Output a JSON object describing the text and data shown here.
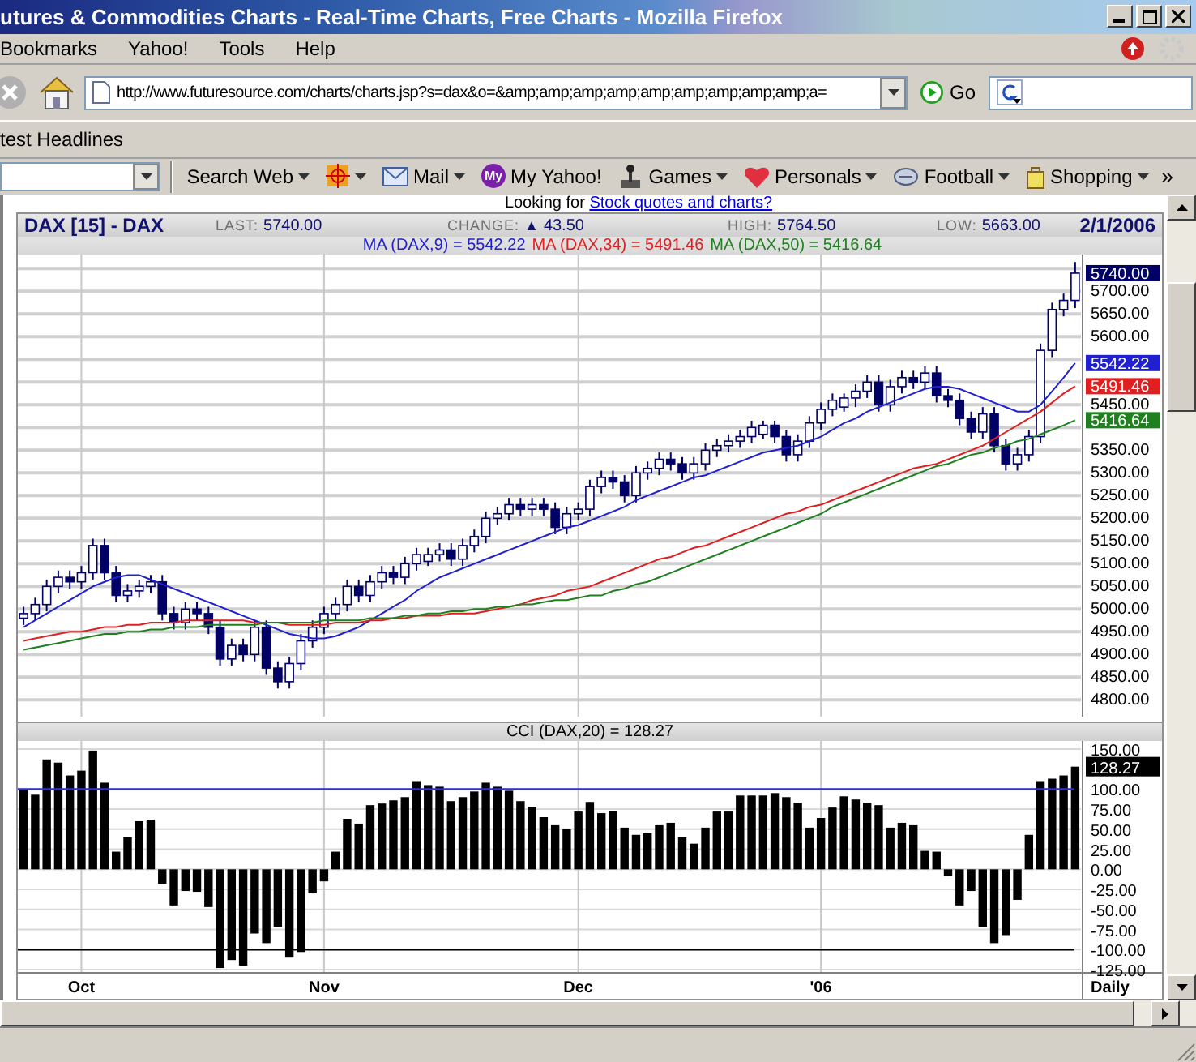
{
  "window": {
    "title": "utures & Commodities Charts - Real-Time Charts, Free Charts - Mozilla Firefox"
  },
  "menu": [
    "Bookmarks",
    "Yahoo!",
    "Tools",
    "Help"
  ],
  "navigation": {
    "url": "http://www.futuresource.com/charts/charts.jsp?s=dax&o=&amp;amp;amp;amp;amp;amp;amp;amp;amp;a=",
    "go_label": "Go"
  },
  "bookmarks": [
    "test Headlines"
  ],
  "yahoo_toolbar": {
    "items": [
      {
        "kind": "text",
        "label": "Search Web",
        "dropdown": true
      },
      {
        "kind": "crosshair",
        "dropdown": true
      },
      {
        "kind": "mail",
        "label": "Mail",
        "dropdown": true
      },
      {
        "kind": "badge",
        "badge": "My",
        "label": "My Yahoo!",
        "dropdown": false
      },
      {
        "kind": "games",
        "label": "Games",
        "dropdown": true
      },
      {
        "kind": "heart",
        "label": "Personals",
        "dropdown": true
      },
      {
        "kind": "ball",
        "label": "Football",
        "dropdown": true
      },
      {
        "kind": "bag",
        "label": "Shopping",
        "dropdown": true
      }
    ],
    "overflow": "»"
  },
  "page": {
    "promo": {
      "text": "Looking for",
      "link": "Stock quotes and charts?"
    },
    "chart_header": {
      "symbol": "DAX [15] - DAX",
      "stats": [
        {
          "label": "LAST:",
          "value": "5740.00"
        },
        {
          "label": "CHANGE:",
          "marker": "▲",
          "value": "43.50"
        },
        {
          "label": "HIGH:",
          "value": "5764.50"
        },
        {
          "label": "LOW:",
          "value": "5663.00"
        }
      ],
      "date": "2/1/2006"
    },
    "ma_legend": [
      {
        "text": "MA (DAX,9) = 5542.22",
        "color": "#2020d0"
      },
      {
        "text": "MA (DAX,34) = 5491.46",
        "color": "#e02020"
      },
      {
        "text": "MA (DAX,50) = 5416.64",
        "color": "#208020"
      }
    ],
    "price_chart": {
      "chart_data": {
        "type": "candlestick",
        "grid": true,
        "ylim": [
          4763,
          5781
        ],
        "categories": [
          null,
          null,
          null,
          null,
          null,
          null,
          null,
          null,
          null,
          null,
          null,
          null,
          null,
          null,
          null,
          null,
          null,
          null,
          null,
          null,
          null,
          null,
          null,
          null,
          null,
          null,
          null,
          null,
          null,
          null,
          null,
          null,
          null,
          null,
          null,
          null,
          null,
          null,
          null,
          null,
          null,
          null,
          null,
          null,
          null,
          null,
          null,
          null,
          null,
          null,
          null,
          null,
          null,
          null,
          null,
          null,
          null,
          null,
          null,
          null,
          null,
          null,
          null,
          null,
          null,
          null,
          null,
          null,
          null,
          null,
          null,
          null,
          null,
          null,
          null,
          null,
          null,
          null,
          null,
          null,
          null,
          null,
          null,
          null,
          null,
          null,
          null,
          null,
          null,
          null,
          null,
          null
        ],
        "yticks": [
          {
            "value": 4800,
            "label": "4800.00"
          },
          {
            "value": 4850,
            "label": "4850.00"
          },
          {
            "value": 4900,
            "label": "4900.00"
          },
          {
            "value": 4950,
            "label": "4950.00"
          },
          {
            "value": 5000,
            "label": "5000.00"
          },
          {
            "value": 5050,
            "label": "5050.00"
          },
          {
            "value": 5100,
            "label": "5100.00"
          },
          {
            "value": 5150,
            "label": "5150.00"
          },
          {
            "value": 5200,
            "label": "5200.00"
          },
          {
            "value": 5250,
            "label": "5250.00"
          },
          {
            "value": 5300,
            "label": "5300.00"
          },
          {
            "value": 5350,
            "label": "5350.00"
          },
          {
            "value": 5450,
            "label": "5450.00"
          },
          {
            "value": 5600,
            "label": "5600.00"
          },
          {
            "value": 5650,
            "label": "5650.00"
          },
          {
            "value": 5700,
            "label": "5700.00"
          }
        ],
        "ohlc": [
          [
            4980,
            5005,
            4965,
            4990
          ],
          [
            4990,
            5025,
            4975,
            5010
          ],
          [
            5010,
            5065,
            4995,
            5050
          ],
          [
            5050,
            5085,
            5035,
            5070
          ],
          [
            5070,
            5085,
            5045,
            5060
          ],
          [
            5060,
            5095,
            5045,
            5080
          ],
          [
            5080,
            5155,
            5065,
            5140
          ],
          [
            5140,
            5155,
            5065,
            5080
          ],
          [
            5080,
            5095,
            5015,
            5030
          ],
          [
            5030,
            5055,
            5015,
            5040
          ],
          [
            5040,
            5065,
            5025,
            5050
          ],
          [
            5050,
            5075,
            5035,
            5060
          ],
          [
            5060,
            5075,
            4975,
            4990
          ],
          [
            4990,
            5005,
            4955,
            4970
          ],
          [
            4970,
            5015,
            4955,
            5000
          ],
          [
            5000,
            5015,
            4975,
            4990
          ],
          [
            4990,
            5005,
            4945,
            4960
          ],
          [
            4960,
            4975,
            4875,
            4890
          ],
          [
            4890,
            4935,
            4875,
            4920
          ],
          [
            4920,
            4935,
            4885,
            4900
          ],
          [
            4900,
            4975,
            4885,
            4960
          ],
          [
            4960,
            4975,
            4855,
            4870
          ],
          [
            4870,
            4885,
            4825,
            4840
          ],
          [
            4840,
            4895,
            4825,
            4880
          ],
          [
            4880,
            4945,
            4865,
            4930
          ],
          [
            4930,
            4975,
            4915,
            4960
          ],
          [
            4960,
            5005,
            4945,
            4990
          ],
          [
            4990,
            5025,
            4975,
            5010
          ],
          [
            5010,
            5065,
            4995,
            5050
          ],
          [
            5050,
            5065,
            5015,
            5030
          ],
          [
            5030,
            5075,
            5015,
            5060
          ],
          [
            5060,
            5095,
            5045,
            5080
          ],
          [
            5080,
            5095,
            5055,
            5070
          ],
          [
            5070,
            5115,
            5055,
            5100
          ],
          [
            5100,
            5135,
            5085,
            5120
          ],
          [
            5105,
            5135,
            5095,
            5120
          ],
          [
            5120,
            5145,
            5105,
            5130
          ],
          [
            5130,
            5145,
            5095,
            5110
          ],
          [
            5110,
            5155,
            5095,
            5140
          ],
          [
            5140,
            5175,
            5125,
            5160
          ],
          [
            5160,
            5215,
            5145,
            5200
          ],
          [
            5200,
            5225,
            5185,
            5210
          ],
          [
            5210,
            5245,
            5195,
            5230
          ],
          [
            5230,
            5245,
            5205,
            5220
          ],
          [
            5220,
            5245,
            5205,
            5230
          ],
          [
            5230,
            5245,
            5205,
            5220
          ],
          [
            5220,
            5235,
            5165,
            5180
          ],
          [
            5180,
            5225,
            5165,
            5210
          ],
          [
            5210,
            5235,
            5195,
            5220
          ],
          [
            5220,
            5285,
            5205,
            5270
          ],
          [
            5270,
            5305,
            5255,
            5290
          ],
          [
            5290,
            5305,
            5265,
            5280
          ],
          [
            5280,
            5295,
            5235,
            5250
          ],
          [
            5250,
            5315,
            5235,
            5300
          ],
          [
            5300,
            5325,
            5285,
            5310
          ],
          [
            5310,
            5345,
            5295,
            5330
          ],
          [
            5330,
            5345,
            5305,
            5320
          ],
          [
            5320,
            5335,
            5285,
            5300
          ],
          [
            5300,
            5335,
            5285,
            5320
          ],
          [
            5320,
            5365,
            5305,
            5350
          ],
          [
            5350,
            5375,
            5335,
            5360
          ],
          [
            5360,
            5385,
            5345,
            5370
          ],
          [
            5370,
            5395,
            5355,
            5380
          ],
          [
            5380,
            5415,
            5365,
            5400
          ],
          [
            5385,
            5415,
            5375,
            5405
          ],
          [
            5405,
            5415,
            5365,
            5380
          ],
          [
            5380,
            5395,
            5325,
            5340
          ],
          [
            5340,
            5385,
            5325,
            5370
          ],
          [
            5370,
            5425,
            5355,
            5410
          ],
          [
            5410,
            5455,
            5395,
            5440
          ],
          [
            5440,
            5475,
            5425,
            5460
          ],
          [
            5445,
            5475,
            5435,
            5465
          ],
          [
            5465,
            5495,
            5445,
            5480
          ],
          [
            5480,
            5515,
            5465,
            5500
          ],
          [
            5500,
            5515,
            5435,
            5450
          ],
          [
            5450,
            5505,
            5435,
            5490
          ],
          [
            5490,
            5525,
            5475,
            5510
          ],
          [
            5510,
            5525,
            5485,
            5500
          ],
          [
            5500,
            5535,
            5485,
            5520
          ],
          [
            5520,
            5535,
            5455,
            5470
          ],
          [
            5470,
            5485,
            5445,
            5460
          ],
          [
            5460,
            5475,
            5405,
            5420
          ],
          [
            5420,
            5435,
            5375,
            5390
          ],
          [
            5390,
            5445,
            5375,
            5430
          ],
          [
            5430,
            5445,
            5345,
            5360
          ],
          [
            5360,
            5375,
            5305,
            5320
          ],
          [
            5320,
            5355,
            5305,
            5340
          ],
          [
            5340,
            5395,
            5325,
            5380
          ],
          [
            5380,
            5585,
            5365,
            5570
          ],
          [
            5570,
            5675,
            5555,
            5660
          ],
          [
            5660,
            5695,
            5645,
            5680
          ],
          [
            5680,
            5764.5,
            5663,
            5740
          ]
        ],
        "series": [
          {
            "type": "line",
            "color": "#2020d0",
            "values": [
              4960,
              4975,
              4990,
              5005,
              5020,
              5035,
              5050,
              5060,
              5070,
              5075,
              5075,
              5065,
              5055,
              5045,
              5035,
              5025,
              5015,
              5005,
              4995,
              4985,
              4975,
              4965,
              4955,
              4945,
              4940,
              4935,
              4935,
              4940,
              4950,
              4960,
              4975,
              4990,
              5005,
              5020,
              5040,
              5055,
              5070,
              5080,
              5090,
              5100,
              5110,
              5120,
              5130,
              5140,
              5150,
              5160,
              5170,
              5180,
              5185,
              5195,
              5205,
              5215,
              5225,
              5240,
              5250,
              5260,
              5270,
              5280,
              5290,
              5295,
              5305,
              5315,
              5325,
              5335,
              5345,
              5350,
              5355,
              5360,
              5370,
              5380,
              5395,
              5410,
              5420,
              5435,
              5445,
              5455,
              5465,
              5475,
              5485,
              5490,
              5490,
              5485,
              5475,
              5465,
              5455,
              5445,
              5435,
              5435,
              5450,
              5480,
              5510,
              5542
            ]
          },
          {
            "type": "line",
            "color": "#e02020",
            "values": [
              4930,
              4935,
              4940,
              4945,
              4950,
              4950,
              4955,
              4960,
              4960,
              4965,
              4965,
              4970,
              4970,
              4970,
              4975,
              4975,
              4975,
              4975,
              4975,
              4975,
              4970,
              4970,
              4970,
              4965,
              4965,
              4965,
              4965,
              4970,
              4970,
              4970,
              4975,
              4975,
              4980,
              4980,
              4985,
              4985,
              4985,
              4990,
              4990,
              4990,
              4995,
              5000,
              5005,
              5010,
              5020,
              5025,
              5030,
              5040,
              5045,
              5050,
              5060,
              5070,
              5080,
              5090,
              5100,
              5110,
              5115,
              5125,
              5135,
              5140,
              5150,
              5160,
              5170,
              5180,
              5190,
              5200,
              5210,
              5215,
              5225,
              5230,
              5240,
              5250,
              5260,
              5270,
              5280,
              5290,
              5300,
              5310,
              5315,
              5320,
              5330,
              5340,
              5350,
              5360,
              5375,
              5390,
              5405,
              5420,
              5435,
              5455,
              5475,
              5491
            ]
          },
          {
            "type": "line",
            "color": "#208020",
            "values": [
              4910,
              4915,
              4920,
              4925,
              4930,
              4935,
              4940,
              4945,
              4945,
              4950,
              4950,
              4955,
              4955,
              4960,
              4960,
              4960,
              4965,
              4965,
              4965,
              4965,
              4965,
              4970,
              4970,
              4970,
              4970,
              4970,
              4975,
              4975,
              4975,
              4975,
              4980,
              4980,
              4980,
              4985,
              4985,
              4990,
              4990,
              4995,
              4995,
              5000,
              5000,
              5005,
              5005,
              5010,
              5010,
              5015,
              5020,
              5020,
              5025,
              5030,
              5030,
              5040,
              5045,
              5055,
              5060,
              5070,
              5080,
              5090,
              5100,
              5110,
              5120,
              5130,
              5140,
              5150,
              5160,
              5170,
              5180,
              5190,
              5200,
              5210,
              5225,
              5235,
              5245,
              5255,
              5265,
              5275,
              5285,
              5295,
              5305,
              5315,
              5320,
              5330,
              5340,
              5345,
              5355,
              5360,
              5370,
              5375,
              5385,
              5395,
              5405,
              5416
            ]
          }
        ]
      }
    },
    "price_tags": [
      "5740.00",
      "5542.22",
      "5491.46",
      "5416.64"
    ],
    "cci_header": "CCI (DAX,20) = 128.27",
    "cci_chart": {
      "chart_data": {
        "type": "bar",
        "grid": true,
        "ylim": [
          -129,
          160
        ],
        "yticks": [
          {
            "value": -125,
            "label": "-125.00"
          },
          {
            "value": -100,
            "label": "-100.00"
          },
          {
            "value": -75,
            "label": "-75.00"
          },
          {
            "value": -50,
            "label": "-50.00"
          },
          {
            "value": -25,
            "label": "-25.00"
          },
          {
            "value": 0,
            "label": "0.00"
          },
          {
            "value": 25,
            "label": "25.00"
          },
          {
            "value": 50,
            "label": "50.00"
          },
          {
            "value": 75,
            "label": "75.00"
          },
          {
            "value": 100,
            "label": "100.00"
          },
          {
            "value": 150,
            "label": "150.00"
          }
        ],
        "categories": [
          null,
          null,
          null,
          null,
          null,
          "Oct",
          null,
          null,
          null,
          null,
          null,
          null,
          null,
          null,
          null,
          null,
          null,
          null,
          null,
          null,
          null,
          null,
          null,
          null,
          null,
          null,
          "Nov",
          null,
          null,
          null,
          null,
          null,
          null,
          null,
          null,
          null,
          null,
          null,
          null,
          null,
          null,
          null,
          null,
          null,
          null,
          null,
          null,
          null,
          "Dec",
          null,
          null,
          null,
          null,
          null,
          null,
          null,
          null,
          null,
          null,
          null,
          null,
          null,
          null,
          null,
          null,
          null,
          null,
          null,
          null,
          "'06",
          null,
          null,
          null,
          null,
          null,
          null,
          null,
          null,
          null,
          null,
          null,
          null,
          null,
          null,
          null,
          null,
          null,
          null,
          null,
          null,
          null,
          null
        ],
        "series": [
          {
            "color": "#000000",
            "values": [
              100,
              93,
              137,
              133,
              117,
              123,
              148,
              108,
              22,
              40,
              60,
              62,
              -18,
              -45,
              -27,
              -28,
              -47,
              -123,
              -113,
              -120,
              -80,
              -92,
              -72,
              -110,
              -103,
              -30,
              -15,
              22,
              63,
              57,
              80,
              82,
              86,
              90,
              110,
              105,
              103,
              85,
              90,
              97,
              108,
              103,
              98,
              85,
              78,
              65,
              55,
              50,
              72,
              84,
              70,
              73,
              52,
              43,
              45,
              55,
              58,
              40,
              32,
              52,
              72,
              72,
              92,
              92,
              92,
              95,
              90,
              83,
              52,
              64,
              77,
              91,
              87,
              83,
              80,
              52,
              58,
              55,
              23,
              22,
              -8,
              -45,
              -27,
              -72,
              -92,
              -82,
              -38,
              43,
              110,
              113,
              117,
              128
            ]
          }
        ],
        "ref_lines": [
          {
            "axis": "y",
            "value": 100,
            "color": "#3030d0"
          },
          {
            "axis": "y",
            "value": -100,
            "color": "#000000"
          }
        ]
      }
    },
    "cci_tag": "128.27",
    "period": "Daily"
  }
}
